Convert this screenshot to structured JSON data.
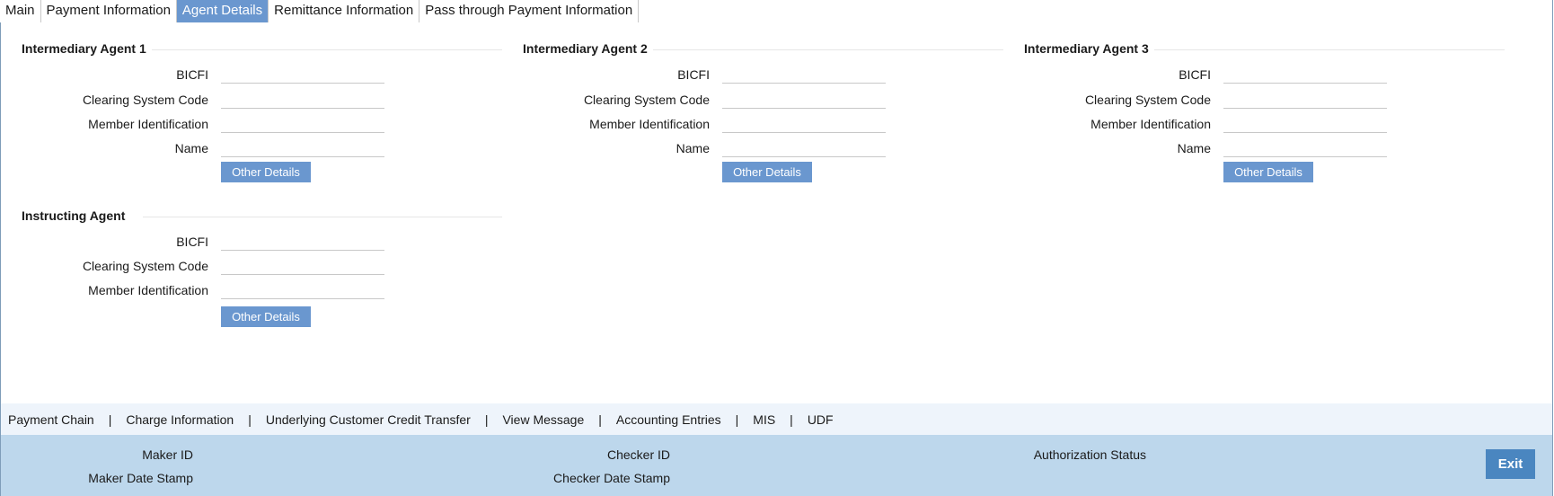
{
  "tabs": [
    {
      "label": "Main",
      "active": false
    },
    {
      "label": "Payment Information",
      "active": false
    },
    {
      "label": "Agent Details",
      "active": true
    },
    {
      "label": "Remittance Information",
      "active": false
    },
    {
      "label": "Pass through Payment Information",
      "active": false
    }
  ],
  "intermediary_agent_1": {
    "title": "Intermediary Agent 1",
    "bicfi_label": "BICFI",
    "bicfi_value": "",
    "clearing_label": "Clearing System Code",
    "clearing_value": "",
    "member_label": "Member Identification",
    "member_value": "",
    "name_label": "Name",
    "name_value": "",
    "button_label": "Other Details"
  },
  "intermediary_agent_2": {
    "title": "Intermediary Agent 2",
    "bicfi_label": "BICFI",
    "bicfi_value": "",
    "clearing_label": "Clearing System Code",
    "clearing_value": "",
    "member_label": "Member Identification",
    "member_value": "",
    "name_label": "Name",
    "name_value": "",
    "button_label": "Other Details"
  },
  "intermediary_agent_3": {
    "title": "Intermediary Agent 3",
    "bicfi_label": "BICFI",
    "bicfi_value": "",
    "clearing_label": "Clearing System Code",
    "clearing_value": "",
    "member_label": "Member Identification",
    "member_value": "",
    "name_label": "Name",
    "name_value": "",
    "button_label": "Other Details"
  },
  "instructing_agent": {
    "title": "Instructing Agent",
    "bicfi_label": "BICFI",
    "bicfi_value": "",
    "clearing_label": "Clearing System Code",
    "clearing_value": "",
    "member_label": "Member Identification",
    "member_value": "",
    "button_label": "Other Details"
  },
  "links": {
    "separator": "|",
    "items": [
      "Payment Chain",
      "Charge Information",
      "Underlying Customer Credit Transfer",
      "View Message",
      "Accounting Entries",
      "MIS",
      "UDF"
    ]
  },
  "footer": {
    "maker_id_label": "Maker ID",
    "maker_date_label": "Maker Date Stamp",
    "checker_id_label": "Checker ID",
    "checker_date_label": "Checker Date Stamp",
    "auth_status_label": "Authorization Status",
    "exit_label": "Exit"
  },
  "colors": {
    "active_tab": "#6a97cf",
    "button": "#6a97cf",
    "footer_bg": "#bdd7ec",
    "linkbar_bg": "#eef4fb",
    "exit_button": "#4a86c0"
  }
}
